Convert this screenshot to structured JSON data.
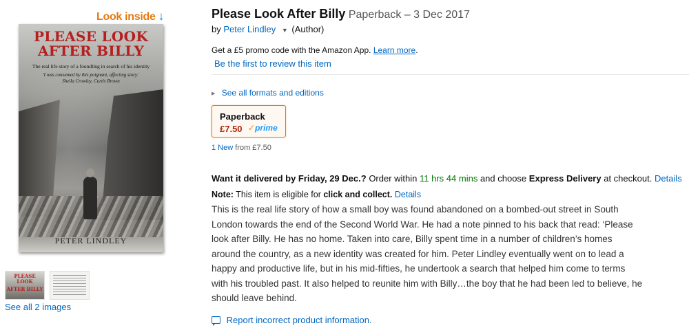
{
  "gallery": {
    "look_inside": "Look inside",
    "cover": {
      "title_line1": "PLEASE LOOK",
      "title_line2": "AFTER BILLY",
      "subtitle": "The real life story of a foundling in search of his identity",
      "quote_line1": "'I was consumed by this poignant, affecting story.'",
      "quote_line2": "Sheila Crowley, Curtis Brown",
      "author": "PETER LINDLEY"
    },
    "thumb1_text_line1": "PLEASE LOOK",
    "thumb1_text_line2": "AFTER BILLY",
    "see_all": "See all 2 images"
  },
  "product": {
    "title": "Please Look After Billy",
    "format": "Paperback – 3 Dec 2017",
    "by": "by",
    "author": "Peter Lindley",
    "author_role": "(Author)",
    "promo_text": "Get a £5 promo code with the Amazon App.",
    "promo_link": "Learn more",
    "promo_end": ".",
    "review_link": "Be the first to review this item",
    "formats_link": "See all formats and editions",
    "swatch": {
      "name": "Paperback",
      "price": "£7.50",
      "prime": "prime",
      "prime_check": "✓"
    },
    "new_from": {
      "link": "1 New",
      "rest": "from £7.50"
    },
    "delivery": {
      "part1": "Want it delivered by Friday, 29 Dec.?",
      "part2": "Order within",
      "time": "11 hrs 44 mins",
      "part3": "and choose",
      "express": "Express Delivery",
      "part4": "at checkout.",
      "details": "Details"
    },
    "note": {
      "label": "Note:",
      "text": "This item is eligible for",
      "bold": "click and collect.",
      "details": "Details"
    },
    "description_lines": [
      "This is the real life story of how a small boy was found abandoned on a bombed-out street in South",
      "London towards the end of the Second World War. He had a note pinned to his back that read: ‘Please",
      "look after Billy. He has no home. Taken into care, Billy spent time in a number of children’s homes",
      "around the country, as a new identity was created for him. Peter Lindley eventually went on to lead a",
      "happy and productive life, but in his mid-fifties, he undertook a search that helped him come to terms",
      "with his troubled past. It also helped to reunite him with Billy…the boy that he had been led to believe, he",
      "should leave behind."
    ],
    "report_link": "Report incorrect product information."
  },
  "colors": {
    "link": "#0066c0",
    "price": "#b12704",
    "look_inside": "#e47911",
    "in_stock_green": "#007600",
    "swatch_border": "#e77600"
  }
}
